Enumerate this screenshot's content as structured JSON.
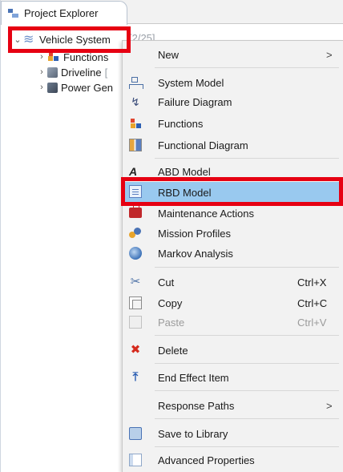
{
  "view": {
    "tab_title": "Project Explorer"
  },
  "tree": {
    "root": {
      "label": "Vehicle System",
      "suffix": "[2/25]"
    },
    "children": [
      {
        "label": "Functions"
      },
      {
        "label": "Driveline",
        "suffix": "["
      },
      {
        "label": "Power Gen"
      }
    ]
  },
  "menu": {
    "new": {
      "label": "New",
      "submenu_arrow": ">"
    },
    "system_model": {
      "label": "System Model"
    },
    "failure_diagram": {
      "label": "Failure Diagram"
    },
    "functions": {
      "label": "Functions"
    },
    "functional_diagram": {
      "label": "Functional Diagram"
    },
    "abd_model": {
      "label": "ABD Model"
    },
    "rbd_model": {
      "label": "RBD Model"
    },
    "maintenance_actions": {
      "label": "Maintenance Actions"
    },
    "mission_profiles": {
      "label": "Mission Profiles"
    },
    "markov_analysis": {
      "label": "Markov Analysis"
    },
    "cut": {
      "label": "Cut",
      "shortcut": "Ctrl+X"
    },
    "copy": {
      "label": "Copy",
      "shortcut": "Ctrl+C"
    },
    "paste": {
      "label": "Paste",
      "shortcut": "Ctrl+V"
    },
    "delete": {
      "label": "Delete"
    },
    "end_effect_item": {
      "label": "End Effect Item"
    },
    "response_paths": {
      "label": "Response Paths",
      "submenu_arrow": ">"
    },
    "save_to_library": {
      "label": "Save to Library"
    },
    "advanced_properties": {
      "label": "Advanced Properties"
    }
  },
  "colors": {
    "highlight": "#99c9ef",
    "annotation_red": "#e60012",
    "menu_bg": "#f2f2f2"
  }
}
